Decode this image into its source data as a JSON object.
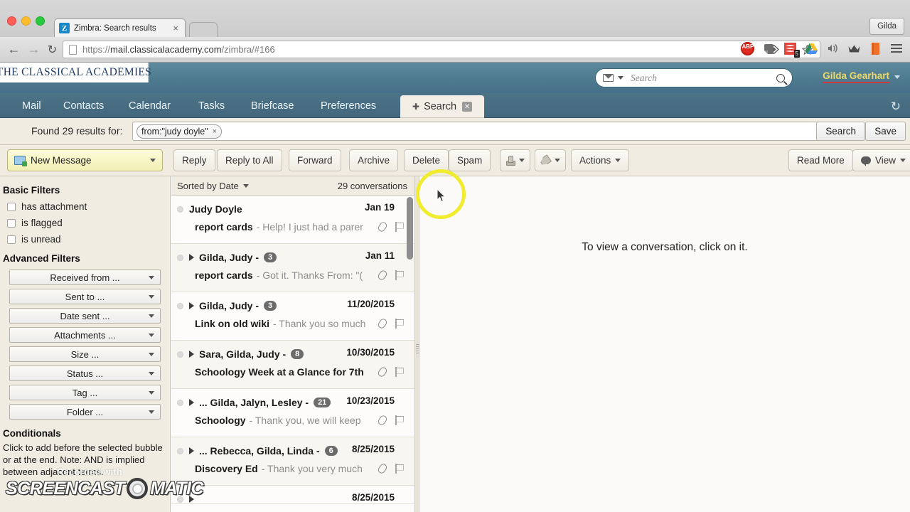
{
  "browser": {
    "tab": {
      "title": "Zimbra: Search results",
      "favicon_letter": "Z",
      "close": "×"
    },
    "profile_button": "Gilda",
    "nav": {
      "back": "←",
      "forward": "→",
      "reload": "↻"
    },
    "url": {
      "scheme": "https://",
      "host": "mail.classicalacademy.com",
      "path": "/zimbra/#166"
    },
    "omnibox_icons": [
      "bookmark-sync-icon",
      "zoom-icon",
      "star-icon"
    ],
    "extensions": [
      {
        "name": "adblock-plus-icon",
        "label": "ABP"
      },
      {
        "name": "evernote-icon",
        "label": ""
      },
      {
        "name": "pocket-stack-icon",
        "label": "",
        "badge": "5"
      },
      {
        "name": "google-drive-icon",
        "label": ""
      },
      {
        "name": "sound-icon",
        "label": ""
      },
      {
        "name": "crown-icon",
        "label": ""
      },
      {
        "name": "orange-book-icon",
        "label": ""
      },
      {
        "name": "chrome-menu-icon",
        "label": ""
      }
    ]
  },
  "app_header": {
    "logo_text": "THE CLASSICAL ACADEMIES",
    "search_placeholder": "Search",
    "search_value": "",
    "user_name": "Gilda Gearhart",
    "refresh_icon": "↻"
  },
  "app_tabs": [
    {
      "label": "Mail",
      "active": false
    },
    {
      "label": "Contacts",
      "active": false
    },
    {
      "label": "Calendar",
      "active": false
    },
    {
      "label": "Tasks",
      "active": false
    },
    {
      "label": "Briefcase",
      "active": false
    },
    {
      "label": "Preferences",
      "active": false
    },
    {
      "label": "Search",
      "active": true,
      "pinned": true,
      "closable": true
    }
  ],
  "query_row": {
    "found_label": "Found 29 results for:",
    "bubble": "from:\"judy doyle\"",
    "bubble_close": "×",
    "search_button": "Search",
    "save_button": "Save"
  },
  "toolbar": {
    "new_message": "New Message",
    "buttons": [
      "Reply",
      "Reply to All",
      "Forward",
      "Archive",
      "Delete",
      "Spam"
    ],
    "print_label": "",
    "tag_label": "",
    "actions": "Actions",
    "read_more": "Read More",
    "view": "View"
  },
  "sidebar": {
    "basic_title": "Basic Filters",
    "basic_filters": [
      {
        "label": "has attachment",
        "checked": false
      },
      {
        "label": "is flagged",
        "checked": false
      },
      {
        "label": "is unread",
        "checked": false
      }
    ],
    "advanced_title": "Advanced Filters",
    "advanced_filters": [
      "Received from ...",
      "Sent to ...",
      "Date sent ...",
      "Attachments ...",
      "Size ...",
      "Status ...",
      "Tag ...",
      "Folder ..."
    ],
    "conditionals_title": "Conditionals",
    "conditionals_text": "Click to add before the selected bubble or at the end. Note: AND is implied between adjacent terms."
  },
  "conv_list": {
    "sort_label": "Sorted by Date",
    "count_label": "29 conversations",
    "rows": [
      {
        "from": "Judy Doyle",
        "expandable": false,
        "count": "",
        "date": "Jan 19",
        "subject": "report cards",
        "fragment": "- Help! I just had a parer",
        "attachment": true,
        "flag": true
      },
      {
        "from": "Gilda, Judy -",
        "expandable": true,
        "count": "3",
        "date": "Jan 11",
        "subject": "report cards",
        "fragment": "- Got it. Thanks From: \"(",
        "attachment": true,
        "flag": true
      },
      {
        "from": "Gilda, Judy -",
        "expandable": true,
        "count": "3",
        "date": "11/20/2015",
        "subject": "Link on old wiki",
        "fragment": "- Thank you so much",
        "attachment": true,
        "flag": true
      },
      {
        "from": "Sara, Gilda, Judy -",
        "expandable": true,
        "count": "8",
        "date": "10/30/2015",
        "subject": "Schoology Week at a Glance for 7th",
        "fragment": "",
        "attachment": true,
        "flag": true
      },
      {
        "from": "... Gilda, Jalyn, Lesley -",
        "expandable": true,
        "count": "21",
        "date": "10/23/2015",
        "subject": "Schoology",
        "fragment": "- Thank you, we will keep",
        "attachment": true,
        "flag": true
      },
      {
        "from": "... Rebecca, Gilda, Linda -",
        "expandable": true,
        "count": "6",
        "date": "8/25/2015",
        "subject": "Discovery Ed",
        "fragment": "- Thank you very much",
        "attachment": true,
        "flag": true
      },
      {
        "from": "",
        "expandable": true,
        "count": "",
        "date": "8/25/2015",
        "subject": "",
        "fragment": "",
        "attachment": false,
        "flag": false
      }
    ]
  },
  "read_pane": {
    "empty_message": "To view a conversation, click on it."
  },
  "watermark": {
    "recording_text": "Recorded with",
    "brand_left": "SCREENCAST",
    "brand_right": "MATIC"
  },
  "colors": {
    "header_teal": "#4e7a8e",
    "tabbar_teal": "#43687d",
    "panel_beige": "#f0ece2",
    "accent_yellow": "#ecd96b",
    "user_underline_red": "#d03a3a",
    "highlight_ring": "#f2ec2e",
    "badge_gray": "#6b6b6b"
  }
}
